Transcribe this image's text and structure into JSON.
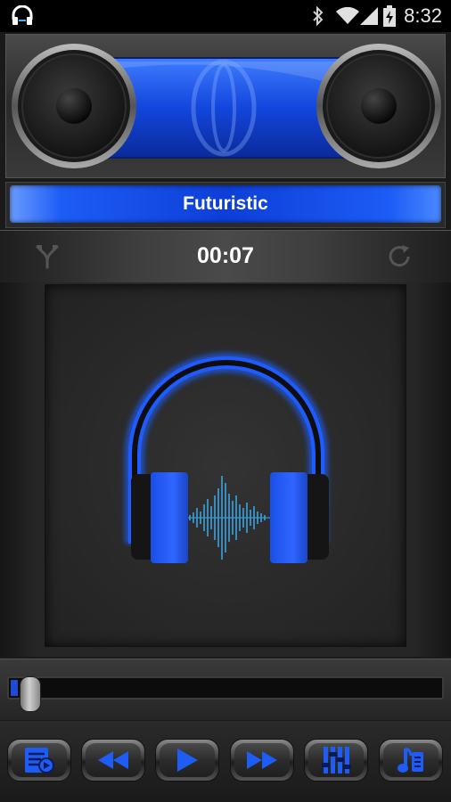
{
  "status_bar": {
    "time": "8:32",
    "icons": [
      "headphones-app-icon",
      "bluetooth-icon",
      "wifi-icon",
      "signal-icon",
      "battery-charging-icon"
    ]
  },
  "player": {
    "title": "Futuristic",
    "elapsed": "00:07",
    "progress_fraction": 0.01
  },
  "controls": [
    {
      "name": "playlist-button",
      "icon": "playlist-icon"
    },
    {
      "name": "rewind-button",
      "icon": "rewind-icon"
    },
    {
      "name": "play-button",
      "icon": "play-icon"
    },
    {
      "name": "fast-forward-button",
      "icon": "fast-forward-icon"
    },
    {
      "name": "equalizer-button",
      "icon": "equalizer-icon"
    },
    {
      "name": "library-button",
      "icon": "music-library-icon"
    }
  ],
  "colors": {
    "accent": "#1d5cf5",
    "accent_dark": "#0d3fd8",
    "background": "#1a1a1a"
  }
}
